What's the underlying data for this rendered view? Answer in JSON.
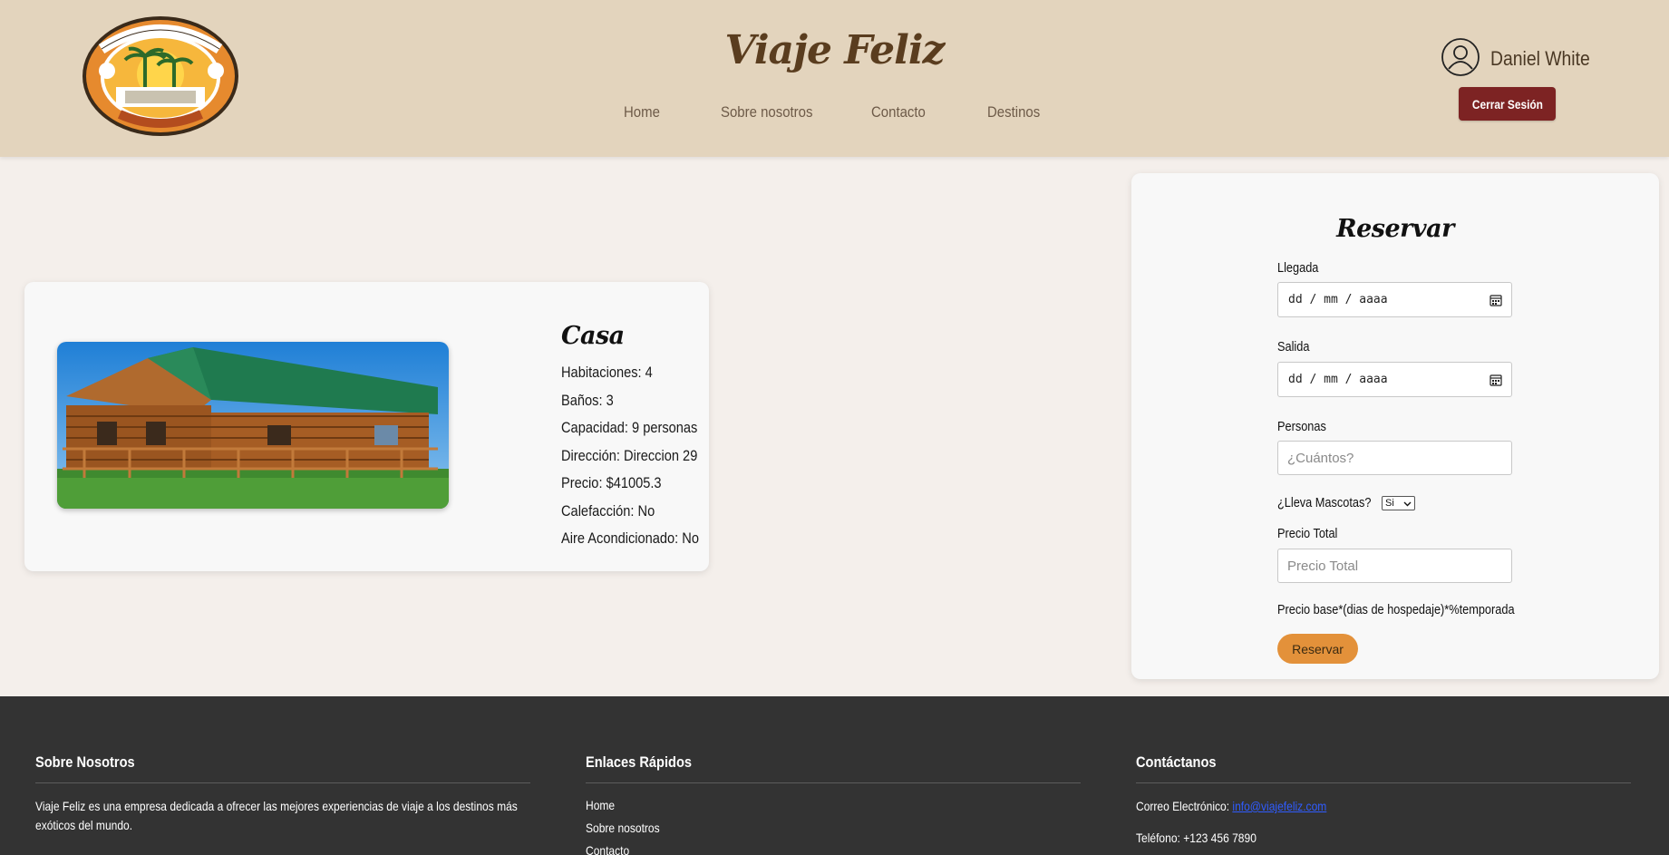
{
  "header": {
    "site_title": "Viaje Feliz",
    "nav": [
      {
        "label": "Home"
      },
      {
        "label": "Sobre nosotros"
      },
      {
        "label": "Contacto"
      },
      {
        "label": "Destinos"
      }
    ],
    "user_name": "Daniel White",
    "logout_label": "Cerrar Sesión",
    "logo_icon": "travel-logo-icon"
  },
  "property": {
    "title": "Casa",
    "details": [
      "Habitaciones: 4",
      "Baños: 3",
      "Capacidad: 9 personas",
      "Dirección: Direccion 29",
      "Precio: $41005.3",
      "Calefacción: No",
      "Aire Acondicionado: No"
    ],
    "photo_icon": "cabin-photo"
  },
  "reservation": {
    "title": "Reservar",
    "arrival_label": "Llegada",
    "arrival_value": "dd / mm / aaaa",
    "departure_label": "Salida",
    "departure_value": "dd / mm / aaaa",
    "people_label": "Personas",
    "people_placeholder": "¿Cuántos?",
    "pets_label": "¿Lleva Mascotas?",
    "pets_value": "Si",
    "total_label": "Precio Total",
    "total_placeholder": "Precio Total",
    "formula": "Precio base*(dias de hospedaje)*%temporada",
    "submit_label": "Reservar"
  },
  "footer": {
    "about_title": "Sobre Nosotros",
    "about_text": "Viaje Feliz es una empresa dedicada a ofrecer las mejores experiencias de viaje a los destinos más exóticos del mundo.",
    "links_title": "Enlaces Rápidos",
    "links": [
      "Home",
      "Sobre nosotros",
      "Contacto"
    ],
    "contact_title": "Contáctanos",
    "email_label": "Correo Electrónico:",
    "email": "info@viajefeliz.com",
    "phone": "Teléfono: +123 456 7890"
  },
  "colors": {
    "header_bg": "#e3d4bd",
    "page_bg": "#f4efeb",
    "logout_bg": "#7d2323",
    "reserve_bg": "#e3913a",
    "footer_bg": "#333333",
    "title_color": "#5a3d1f"
  }
}
